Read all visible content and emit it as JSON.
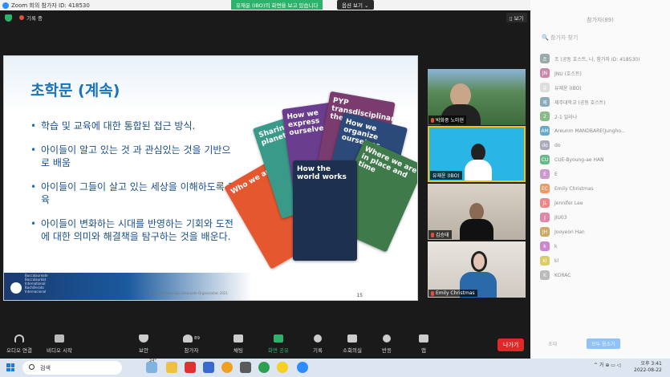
{
  "window": {
    "title": "Zoom 회의 참가자 ID: 418530"
  },
  "banner": {
    "text": "유재윤 (IBO)의 화면을 보고 있습니다",
    "view_options": "옵션 보기 ⌄"
  },
  "status": {
    "recording": "기록 중",
    "view": "▯ 보기"
  },
  "slide": {
    "title": "초학문 (계속)",
    "bullets": [
      "학습 및 교육에 대한 통합된 접근 방식.",
      "아이들이 알고 있는 것 과 관심있는 것을 기반으로 배움",
      "아이들이 그들이 살고 있는 세상을 이해하도록 교육",
      "아이들이 변화하는 시대를 반영하는 기회와 도전에 대한 의미와 해결책을 탐구하는 것을 배운다."
    ],
    "cards": [
      {
        "text": "Who we are",
        "color": "#e5572f"
      },
      {
        "text": "Sharing the planet",
        "color": "#3a9a8a"
      },
      {
        "text": "How we express ourselves",
        "color": "#6b3d8e"
      },
      {
        "text": "PYP transdisciplinary themes",
        "color": "#7a3b6e"
      },
      {
        "text": "How we organize ourselves",
        "color": "#2b4a7a"
      },
      {
        "text": "Where we are in place and time",
        "color": "#3f7a4a"
      },
      {
        "text": "How the world works",
        "color": "#1e3050"
      }
    ],
    "ib_org": "International Baccalaureate Baccalauréat International Bachillerato Internacional",
    "copyright": "© International Baccalaureate Organization 2021",
    "page": "15"
  },
  "videos": [
    {
      "name": "박화중 노마현"
    },
    {
      "name": "유재윤 (IBO)"
    },
    {
      "name": "김승태"
    },
    {
      "name": "Emily Christmas"
    }
  ],
  "toolbar": {
    "audio": "오디오 연결",
    "video": "비디오 시작",
    "security": "보안",
    "participants": "참가자",
    "participants_count": "89",
    "chat": "채팅",
    "share": "화면 공유",
    "record": "기록",
    "rooms": "소회의실",
    "reactions": "반응",
    "apps": "앱",
    "leave": "나가기"
  },
  "panel": {
    "title": "참가자(89)",
    "search": "🔍 참가자 찾기",
    "participants": [
      {
        "initials": "조",
        "name": "조 (공동 호스트, 나, 참가자 ID: 418530)",
        "color": "#9aa"
      },
      {
        "initials": "JN",
        "name": "JNU (호스트)",
        "color": "#c8a"
      },
      {
        "initials": "유",
        "name": "유재윤 (IBO)",
        "color": "#ddd"
      },
      {
        "initials": "제",
        "name": "제주대학교 (공동 호스트)",
        "color": "#8ab"
      },
      {
        "initials": "2",
        "name": "2-1 일라나",
        "color": "#8b8"
      },
      {
        "initials": "AM",
        "name": "Areunm MANDBARE(Jungho...",
        "color": "#6ac"
      },
      {
        "initials": "do",
        "name": "do",
        "color": "#aab"
      },
      {
        "initials": "CU",
        "name": "CUE-Byoung-ae HAN",
        "color": "#6b8"
      },
      {
        "initials": "E",
        "name": "E",
        "color": "#c9c"
      },
      {
        "initials": "EC",
        "name": "Emily Christmas",
        "color": "#e96"
      },
      {
        "initials": "JL",
        "name": "Jennifer Lee",
        "color": "#e88"
      },
      {
        "initials": "J",
        "name": "JIU03",
        "color": "#d8a"
      },
      {
        "initials": "JH",
        "name": "Jooyeon Han",
        "color": "#ca6"
      },
      {
        "initials": "k",
        "name": "k",
        "color": "#c8c"
      },
      {
        "initials": "kl",
        "name": "kl",
        "color": "#dc6"
      },
      {
        "initials": "K",
        "name": "KORAC",
        "color": "#bbb"
      }
    ],
    "invite": "초대",
    "mute_all": "모두 음소거"
  },
  "taskbar": {
    "search": "검색",
    "weather": "24°",
    "tray": "^ 가 ⊕ ▭ ◁",
    "time": "오후 3:41",
    "date": "2022-08-22"
  }
}
